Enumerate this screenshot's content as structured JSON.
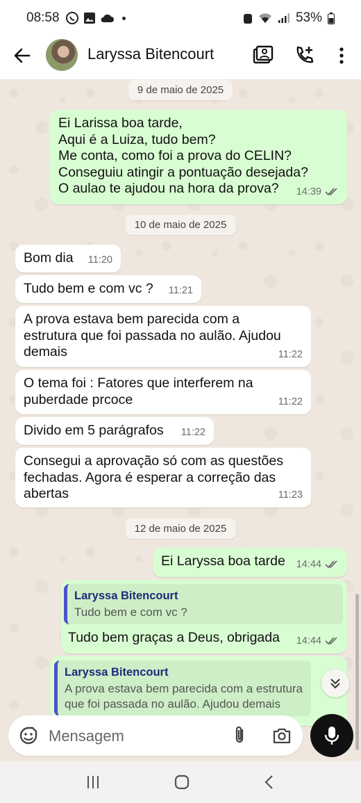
{
  "status_bar": {
    "time": "08:58",
    "battery": "53%"
  },
  "header": {
    "contact_name": "Laryssa Bitencourt"
  },
  "chat": {
    "dates": [
      "9 de maio de 2025",
      "10 de maio de 2025",
      "12 de maio de 2025"
    ],
    "messages": [
      {
        "dir": "out",
        "text": "Ei Larissa boa tarde,\nAqui é a Luiza, tudo bem?\nMe conta, como foi a prova do CELIN?\nConseguiu atingir a pontuação desejada?\nO aulao te ajudou na hora da prova?",
        "time": "14:39"
      },
      {
        "dir": "in",
        "text": "Bom dia",
        "time": "11:20"
      },
      {
        "dir": "in",
        "text": "Tudo bem e com vc ?",
        "time": "11:21"
      },
      {
        "dir": "in",
        "text": "A prova estava bem parecida com a\nestrutura que foi passada no aulão. Ajudou\ndemais",
        "time": "11:22"
      },
      {
        "dir": "in",
        "text": "O tema foi : Fatores que interferem na\npuberdade prcoce",
        "time": "11:22"
      },
      {
        "dir": "in",
        "text": "Divido em 5 parágrafos",
        "time": "11:22"
      },
      {
        "dir": "in",
        "text": "Consegui a aprovação só com as questões\nfechadas. Agora é esperar a correção das\nabertas",
        "time": "11:23"
      },
      {
        "dir": "out",
        "text": "Ei Laryssa boa tarde",
        "time": "14:44"
      },
      {
        "dir": "out",
        "text": "Tudo bem graças a Deus, obrigada",
        "time": "14:44",
        "quote_name": "Laryssa Bitencourt",
        "quote_text": "Tudo bem e com vc ?"
      },
      {
        "dir": "out",
        "quote_name": "Laryssa Bitencourt",
        "quote_text": "A prova estava bem parecida com a estrutura que foi passada no aulão. Ajudou demais"
      }
    ]
  },
  "composer": {
    "placeholder": "Mensagem"
  },
  "colors": {
    "out_bubble": "#d9fdd3",
    "in_bubble": "#ffffff",
    "ticks": "#6b6b6b",
    "quote_bar": "#4b52c9"
  }
}
